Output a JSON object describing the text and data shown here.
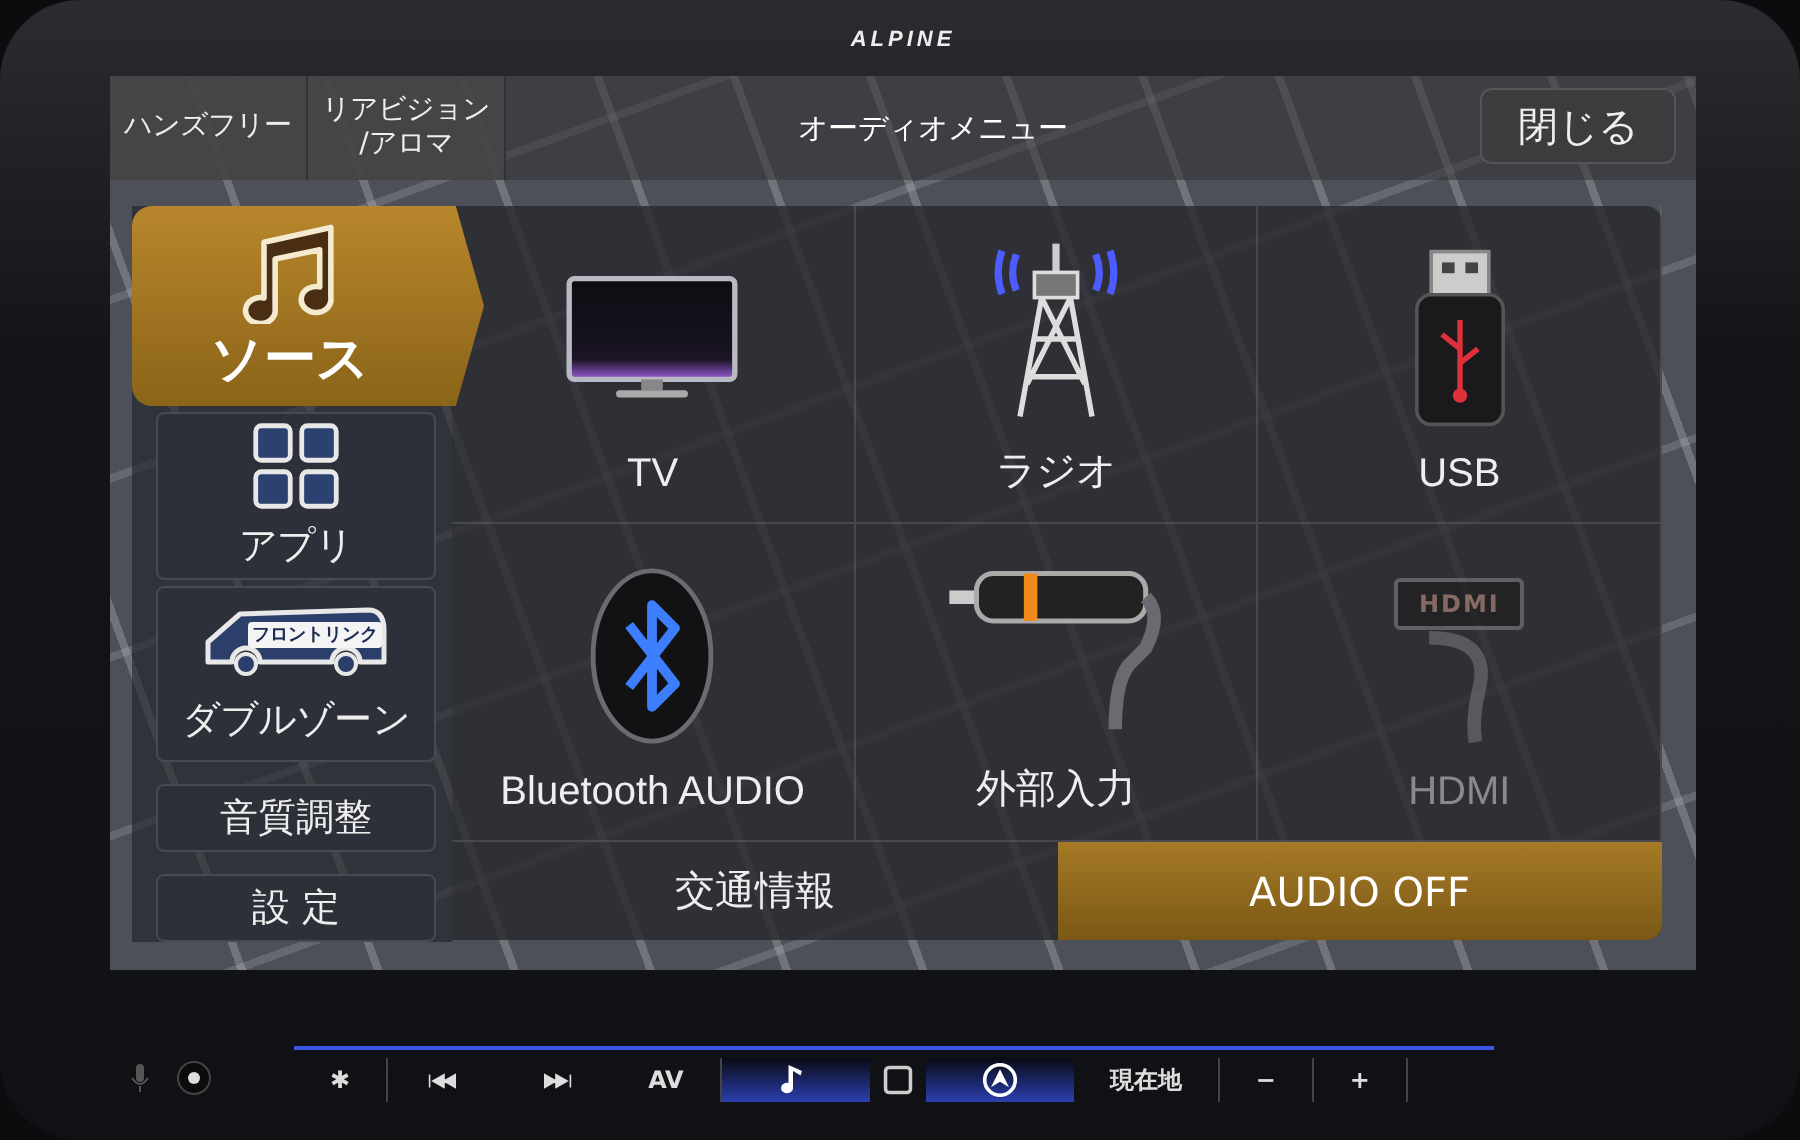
{
  "device": {
    "logo": "ALPINE"
  },
  "header": {
    "buttons": [
      {
        "lines": [
          "ハンズフリー"
        ]
      },
      {
        "lines": [
          "リアビジョン",
          "/アロマ"
        ]
      }
    ],
    "title": "オーディオメニュー",
    "close": "閉じる"
  },
  "sidebar": [
    {
      "kind": "source",
      "label": "ソース",
      "selected": true
    },
    {
      "kind": "apps",
      "label": "アプリ",
      "selected": false
    },
    {
      "kind": "dualzone",
      "label": "ダブルゾーン",
      "badge": "フロントリンク",
      "selected": false
    },
    {
      "kind": "text",
      "label": "音質調整",
      "selected": false
    },
    {
      "kind": "text",
      "label": "設 定",
      "selected": false
    }
  ],
  "sources": [
    {
      "kind": "tv",
      "label": "TV",
      "disabled": false
    },
    {
      "kind": "radio",
      "label": "ラジオ",
      "disabled": false
    },
    {
      "kind": "usb",
      "label": "USB",
      "disabled": false
    },
    {
      "kind": "bluetooth",
      "label": "Bluetooth AUDIO",
      "disabled": false
    },
    {
      "kind": "aux",
      "label": "外部入力",
      "disabled": false
    },
    {
      "kind": "hdmi",
      "label": "HDMI",
      "plug_label": "HDMI",
      "disabled": true
    }
  ],
  "bottom_buttons": [
    {
      "label": "交通情報",
      "selected": false
    },
    {
      "label": "AUDIO OFF",
      "selected": true
    }
  ],
  "hard_keys": [
    {
      "kind": "text",
      "label": "✱"
    },
    {
      "kind": "prev"
    },
    {
      "kind": "next"
    },
    {
      "kind": "text",
      "label": "AV"
    },
    {
      "kind": "music"
    },
    {
      "kind": "home"
    },
    {
      "kind": "nav"
    },
    {
      "kind": "text",
      "label": "現在地"
    },
    {
      "kind": "text",
      "label": "−"
    },
    {
      "kind": "text",
      "label": "+"
    }
  ]
}
